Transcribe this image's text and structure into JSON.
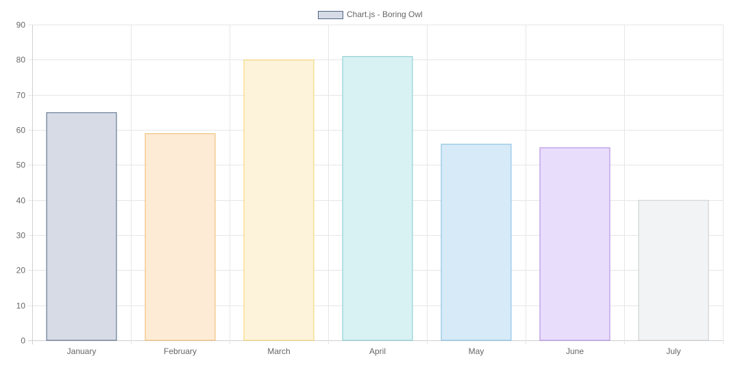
{
  "chart_data": {
    "type": "bar",
    "title": "",
    "xlabel": "",
    "ylabel": "",
    "categories": [
      "January",
      "February",
      "March",
      "April",
      "May",
      "June",
      "July"
    ],
    "series": [
      {
        "name": "Chart.js - Boring Owl",
        "values": [
          65,
          59,
          80,
          81,
          56,
          55,
          40
        ],
        "fill_colors": [
          "#d6dbe5",
          "#fdebd6",
          "#fdf3da",
          "#d8f1f2",
          "#d6eaf8",
          "#e9ddfc",
          "#f2f3f5"
        ],
        "border_colors": [
          "#4e6384",
          "#f0b866",
          "#f5d46a",
          "#7fcbd0",
          "#7fbbe0",
          "#a982e0",
          "#c9cbcf"
        ]
      }
    ],
    "ylim": [
      0,
      90
    ],
    "yticks": [
      0,
      10,
      20,
      30,
      40,
      50,
      60,
      70,
      80,
      90
    ],
    "grid": true,
    "legend": "top-center",
    "legend_swatch": {
      "fill": "#d6dbe5",
      "border": "#4e6384"
    }
  }
}
